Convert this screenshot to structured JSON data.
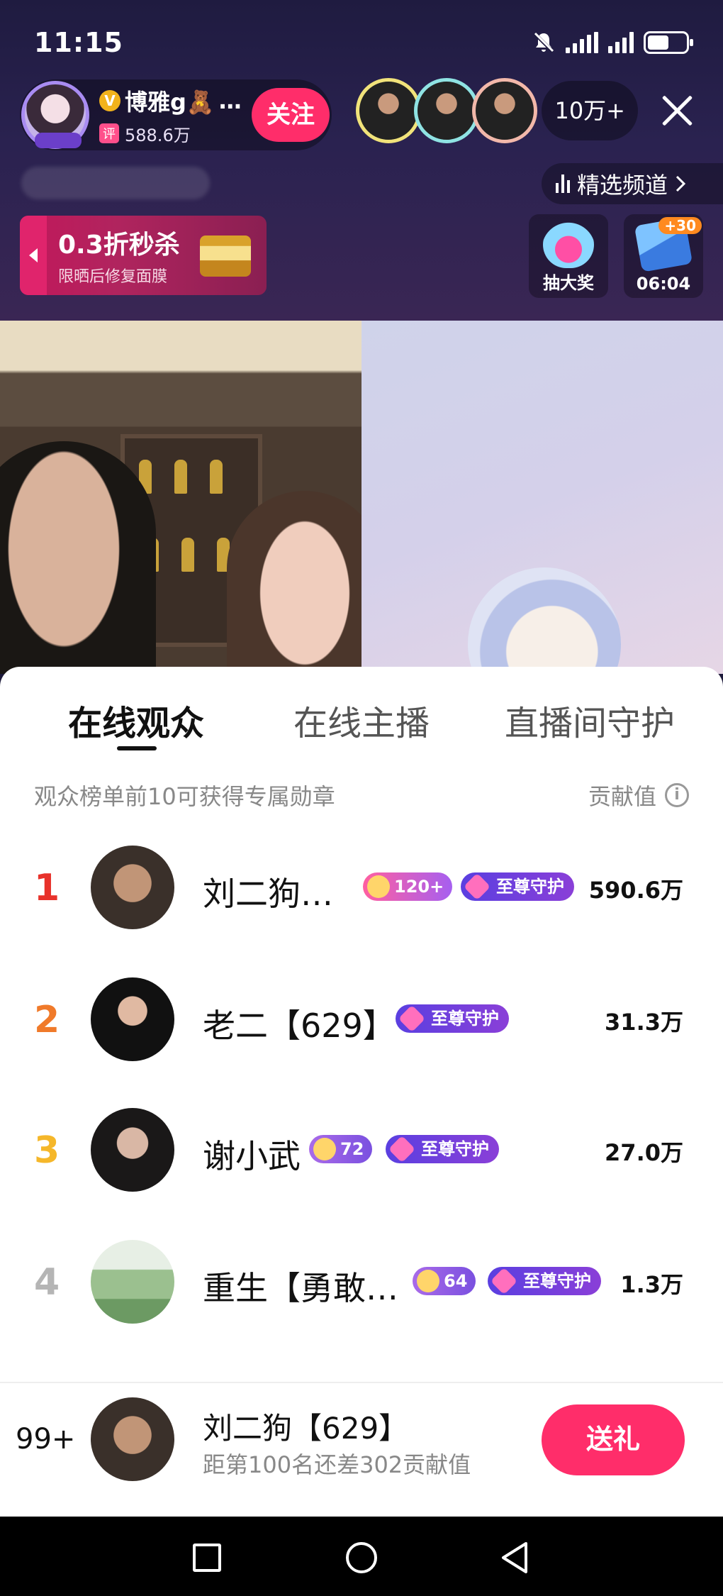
{
  "status_bar": {
    "time": "11:15"
  },
  "host": {
    "name": "博雅g🧸",
    "rating_label": "评",
    "score": "588.6万",
    "follow_label": "关注"
  },
  "viewers": {
    "count": "10万+"
  },
  "channel": {
    "label": "精选频道"
  },
  "promo": {
    "title": "0.3折秒杀",
    "subtitle": "限晒后修复面膜"
  },
  "features": [
    {
      "label": "抽大奖"
    },
    {
      "label": "06:04",
      "badge": "+30"
    }
  ],
  "sheet": {
    "tabs": [
      {
        "label": "在线观众",
        "active": true
      },
      {
        "label": "在线主播",
        "active": false
      },
      {
        "label": "直播间守护",
        "active": false
      }
    ],
    "hint": "观众榜单前10可获得专属勋章",
    "contrib_label": "贡献值",
    "info_icon": "i",
    "rows": [
      {
        "rank": "1",
        "name": "刘二狗…",
        "level": "120+",
        "guard": "至尊守护",
        "value": "590.6万",
        "rank_color": "#e8322b"
      },
      {
        "rank": "2",
        "name": "老二【629】",
        "guard": "至尊守护",
        "value": "31.3万",
        "rank_color": "#f07a2a"
      },
      {
        "rank": "3",
        "name": "谢小武",
        "level": "72",
        "guard": "至尊守护",
        "value": "27.0万",
        "rank_color": "#f5b72a"
      },
      {
        "rank": "4",
        "name": "重生【勇敢…",
        "level": "64",
        "guard": "至尊守护",
        "value": "1.3万",
        "rank_color": "#b5b5b5"
      }
    ],
    "me": {
      "rank": "99+",
      "name": "刘二狗【629】",
      "sub": "距第100名还差302贡献值",
      "gift_label": "送礼"
    }
  }
}
